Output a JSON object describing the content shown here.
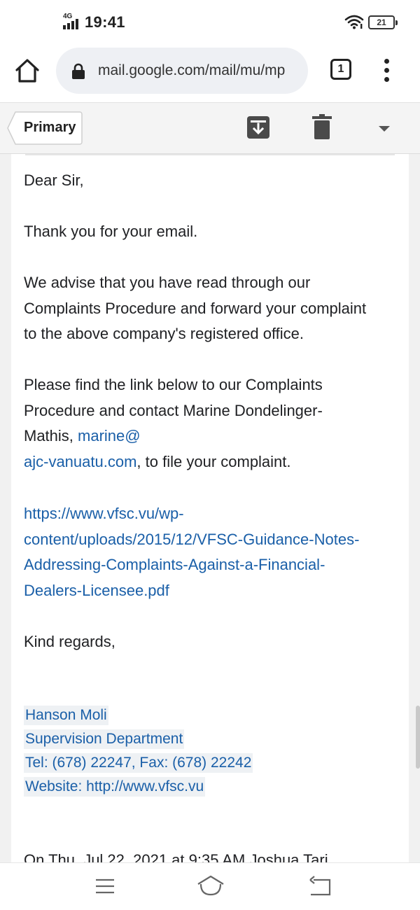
{
  "status_bar": {
    "network": "4G",
    "time": "19:41",
    "battery": "21"
  },
  "browser": {
    "url": "mail.google.com/mail/mu/mp",
    "tab_count": "1"
  },
  "gmail_toolbar": {
    "folder_label": "Primary"
  },
  "email": {
    "greeting": "Dear Sir,",
    "p1": "Thank you for your email.",
    "p2_lines": [
      "We advise that you have read through our",
      "Complaints Procedure and forward your complaint",
      "to the above company's registered office."
    ],
    "p3": {
      "line1": "Please find the link below to our Complaints",
      "line2": "Procedure and contact Marine Dondelinger-",
      "line3_prefix": "Mathis, ",
      "email_part1": "marine@",
      "email_part2": "ajc-vanuatu.com",
      "line4_suffix": ", to file your complaint."
    },
    "link_lines": [
      "https://www.vfsc.vu/wp-",
      "content/uploads/2015/12/VFSC-Guidance-Notes-",
      "Addressing-Complaints-Against-a-Financial-",
      "Dealers-Licensee.pdf"
    ],
    "closing": "Kind regards,",
    "signature": {
      "name": "Hanson Moli",
      "department": "Supervision Department",
      "phone": "Tel: (678) 22247, Fax: (678) 22242",
      "website": "Website: http://www.vfsc.vu"
    },
    "truncated_line": "On Thu, Jul 22, 2021 at 9:35 AM Joshua Tari"
  },
  "colors": {
    "link": "#1a5fa8",
    "text": "#202124",
    "toolbar_bg": "#f4f4f4"
  }
}
